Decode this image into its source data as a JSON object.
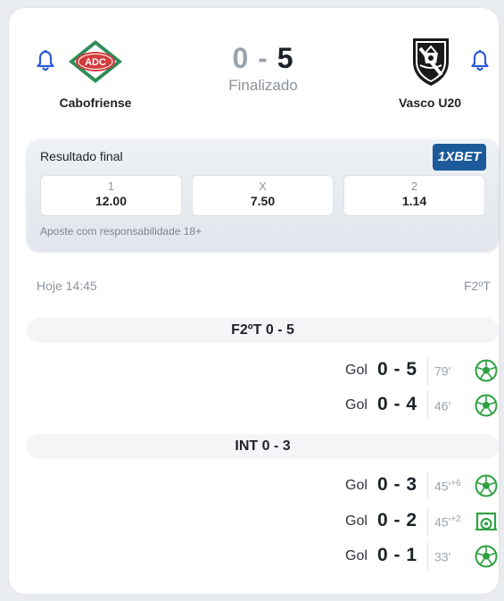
{
  "match": {
    "home_team": "Cabofriense",
    "away_team": "Vasco U20",
    "home_logo_text": "ADC",
    "home_score": "0",
    "away_score": "5",
    "separator": "-",
    "status": "Finalizado"
  },
  "odds": {
    "title": "Resultado final",
    "bookmaker": "1XBET",
    "options": [
      {
        "label": "1",
        "value": "12.00"
      },
      {
        "label": "X",
        "value": "7.50"
      },
      {
        "label": "2",
        "value": "1.14"
      }
    ],
    "disclaimer": "Aposte com responsabilidade 18+"
  },
  "info": {
    "kickoff": "Hoje 14:45",
    "period": "F2ºT"
  },
  "periods": [
    {
      "title": "F2ºT 0 - 5"
    },
    {
      "title": "INT 0 - 3"
    }
  ],
  "events": [
    {
      "type": "Gol",
      "score": "0 - 5",
      "minute": "79'",
      "extra": "",
      "icon": "soccer-ball-icon"
    },
    {
      "type": "Gol",
      "score": "0 - 4",
      "minute": "46'",
      "extra": "",
      "icon": "soccer-ball-icon"
    },
    {
      "type": "Gol",
      "score": "0 - 3",
      "minute": "45'",
      "extra": "+6",
      "icon": "soccer-ball-icon"
    },
    {
      "type": "Gol",
      "score": "0 - 2",
      "minute": "45'",
      "extra": "+2",
      "icon": "penalty-icon"
    },
    {
      "type": "Gol",
      "score": "0 - 1",
      "minute": "33'",
      "extra": "",
      "icon": "soccer-ball-icon"
    }
  ],
  "colors": {
    "accent_blue": "#2f5bd8",
    "goal_green": "#2ea043",
    "bookmaker_blue": "#1c5a9c",
    "home_logo_green": "#2e8b57",
    "home_logo_red": "#d23c3c"
  }
}
